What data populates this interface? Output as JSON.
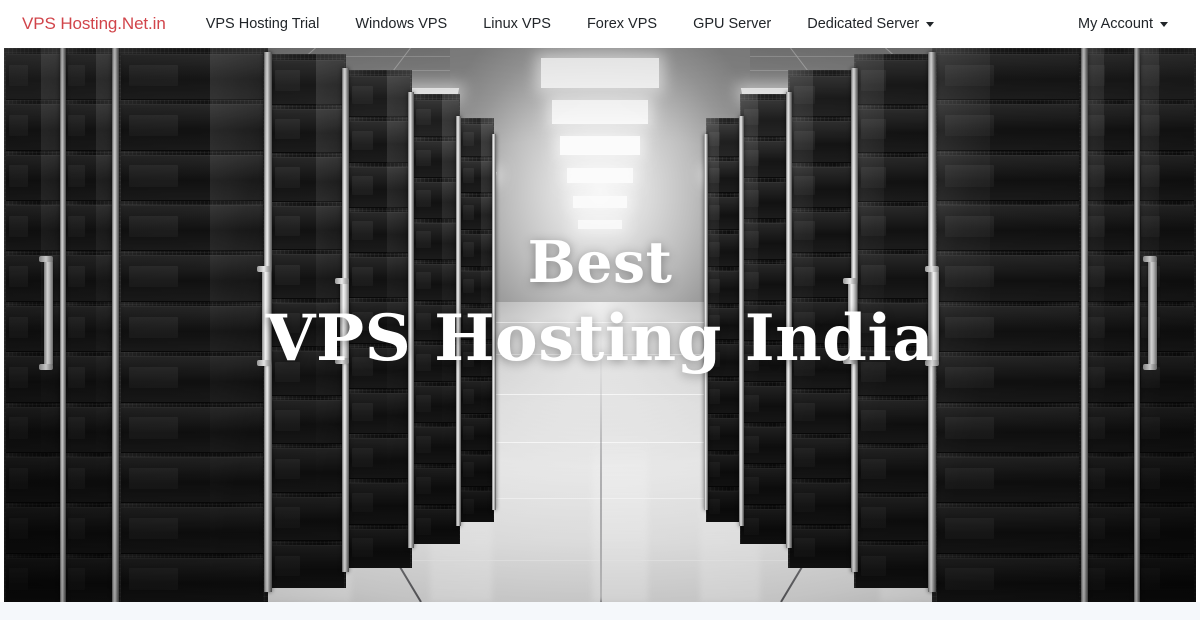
{
  "site": {
    "brand": "VPS Hosting.Net.in",
    "brand_color": "#d1444a"
  },
  "nav": {
    "items": [
      {
        "label": "VPS Hosting Trial",
        "has_dropdown": false
      },
      {
        "label": "Windows VPS",
        "has_dropdown": false
      },
      {
        "label": "Linux VPS",
        "has_dropdown": false
      },
      {
        "label": "Forex VPS",
        "has_dropdown": false
      },
      {
        "label": "GPU Server",
        "has_dropdown": false
      },
      {
        "label": "Dedicated Server",
        "has_dropdown": true
      }
    ],
    "account": {
      "label": "My Account",
      "has_dropdown": true
    }
  },
  "hero": {
    "line1": "Best",
    "line2": "VPS Hosting India",
    "image_description": "data-center-server-room-aisle",
    "text_color": "#ffffff"
  },
  "colors": {
    "nav_text": "#212529",
    "nav_background": "#ffffff",
    "band": "#f5f8fb",
    "page_background": "#ffffff"
  }
}
